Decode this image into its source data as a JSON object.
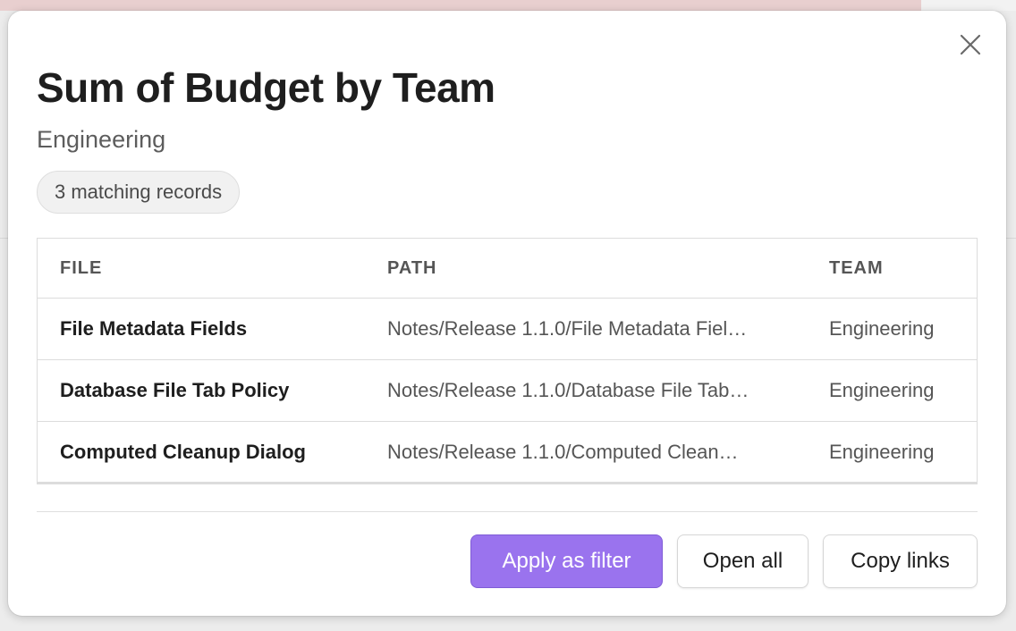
{
  "dialog": {
    "title": "Sum of Budget by Team",
    "subtitle": "Engineering",
    "badge": "3 matching records",
    "close_icon": "close-icon"
  },
  "table": {
    "columns": [
      "FILE",
      "PATH",
      "TEAM"
    ],
    "rows": [
      {
        "file": "File Metadata Fields",
        "path": "Notes/Release 1.1.0/File Metadata Fiel…",
        "team": "Engineering"
      },
      {
        "file": "Database File Tab Policy",
        "path": "Notes/Release 1.1.0/Database File Tab…",
        "team": "Engineering"
      },
      {
        "file": "Computed Cleanup Dialog",
        "path": "Notes/Release 1.1.0/Computed Clean…",
        "team": "Engineering"
      }
    ]
  },
  "actions": {
    "apply_filter": "Apply as filter",
    "open_all": "Open all",
    "copy_links": "Copy links"
  },
  "colors": {
    "accent": "#9a73ee",
    "text_primary": "#1e1e1e",
    "text_secondary": "#5d5d5d"
  }
}
